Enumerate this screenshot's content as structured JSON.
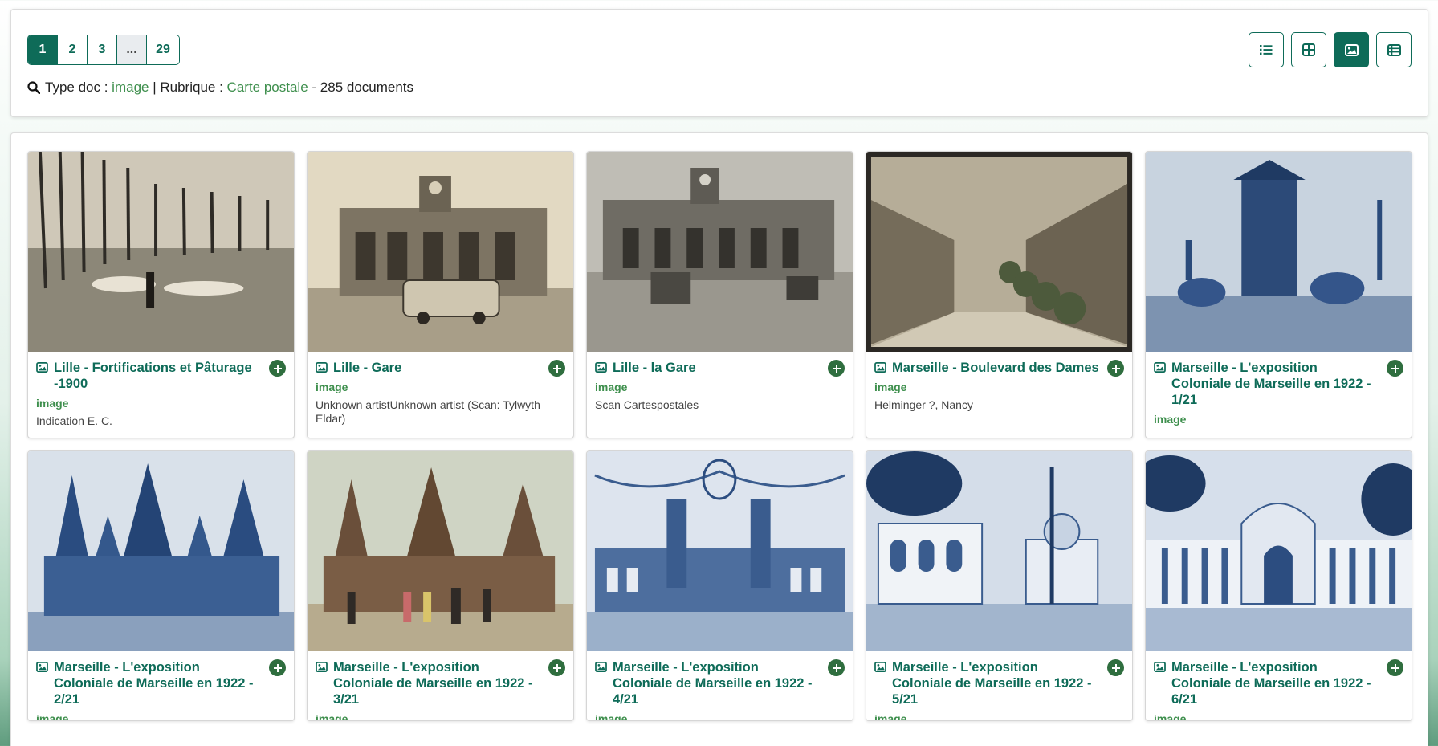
{
  "pagination": {
    "pages": [
      "1",
      "2",
      "3",
      "...",
      "29"
    ],
    "active": "1"
  },
  "summary": {
    "label_type": "Type doc :",
    "type_value": "image",
    "separator": "|",
    "label_rubrique": "Rubrique :",
    "rubrique_value": "Carte postale",
    "count_text": "- 285 documents"
  },
  "views": [
    {
      "name": "list-view-button",
      "icon": "list-icon",
      "active": false
    },
    {
      "name": "grid-view-button",
      "icon": "grid-icon",
      "active": false
    },
    {
      "name": "image-view-button",
      "icon": "image-icon",
      "active": true
    },
    {
      "name": "table-view-button",
      "icon": "table-icon",
      "active": false
    }
  ],
  "colors": {
    "accent": "#0e6b58",
    "link": "#3e8f4d",
    "add_button": "#2f6e3f"
  },
  "cards": [
    {
      "title": "Lille - Fortifications et Pâturage -1900",
      "type": "image",
      "author": "Indication E. C.",
      "tone": "sepia"
    },
    {
      "title": "Lille - Gare",
      "type": "image",
      "author": "Unknown artistUnknown artist (Scan: Tylwyth Eldar)",
      "tone": "sepia"
    },
    {
      "title": "Lille - la Gare",
      "type": "image",
      "author": "Scan Cartespostales",
      "tone": "grey"
    },
    {
      "title": "Marseille - Boulevard des Dames",
      "type": "image",
      "author": "Helminger ?, Nancy",
      "tone": "brown"
    },
    {
      "title": "Marseille - L'exposition Coloniale de Marseille en 1922 - 1/21",
      "type": "image",
      "author": "",
      "tone": "blue"
    },
    {
      "title": "Marseille - L'exposition Coloniale de Marseille en 1922 - 2/21",
      "type": "image",
      "author": "",
      "tone": "blue"
    },
    {
      "title": "Marseille - L'exposition Coloniale de Marseille en 1922 - 3/21",
      "type": "image",
      "author": "",
      "tone": "color"
    },
    {
      "title": "Marseille - L'exposition Coloniale de Marseille en 1922 - 4/21",
      "type": "image",
      "author": "",
      "tone": "blue"
    },
    {
      "title": "Marseille - L'exposition Coloniale de Marseille en 1922 - 5/21",
      "type": "image",
      "author": "",
      "tone": "blue"
    },
    {
      "title": "Marseille - L'exposition Coloniale de Marseille en 1922 - 6/21",
      "type": "image",
      "author": "",
      "tone": "blue"
    }
  ]
}
